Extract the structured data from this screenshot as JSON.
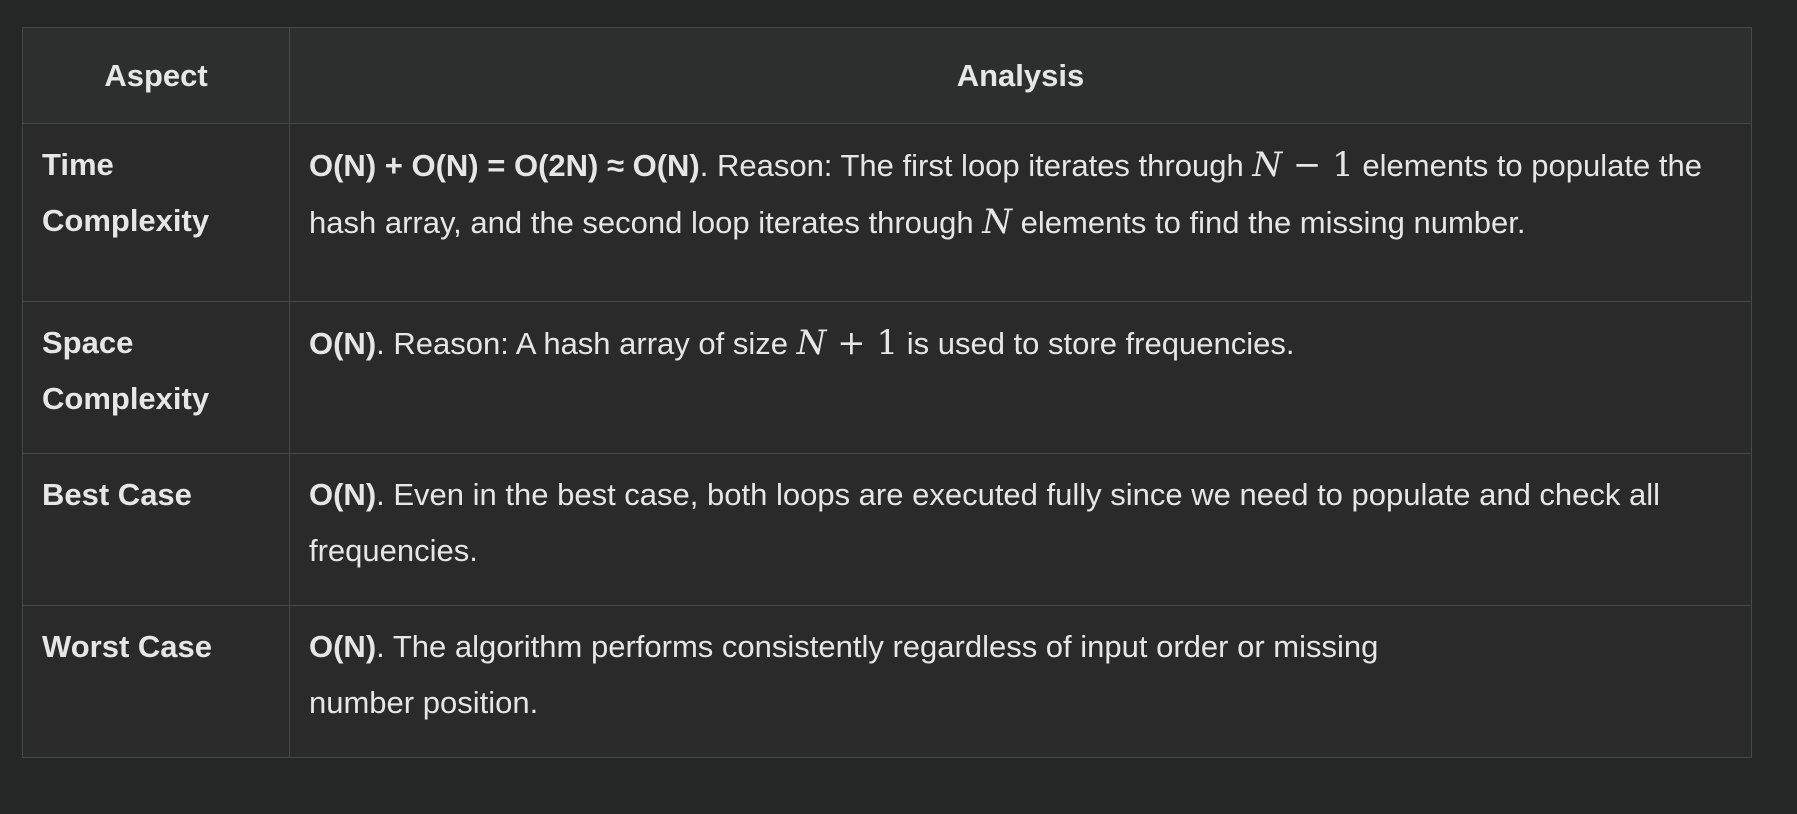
{
  "table": {
    "headers": [
      "Aspect",
      "Analysis"
    ],
    "rows": [
      {
        "aspect_line1": "Time",
        "aspect_line2": "Complexity",
        "lead": "O(N) + O(N) = O(2N) ≈ O(N)",
        "text_a": ". Reason: The first loop iterates through ",
        "math_a_var": "N",
        "math_a_rest": " − 1",
        "text_b": " elements to populate the hash array, and the second loop iterates through ",
        "math_b_var": "N",
        "text_c": " elements to find the missing number."
      },
      {
        "aspect_line1": "Space",
        "aspect_line2": "Complexity",
        "lead": "O(N)",
        "text_a": ". Reason: A hash array of size ",
        "math_a_var": "N",
        "math_a_rest": " + 1",
        "text_b": " is used to store frequencies."
      },
      {
        "aspect": "Best Case",
        "lead": "O(N)",
        "text_a": ". Even in the best case, both loops are executed fully since we need to populate and check all frequencies."
      },
      {
        "aspect": "Worst Case",
        "lead": "O(N)",
        "text_a": ". The algorithm performs consistently regardless of input order or missing",
        "text_b": "number position."
      }
    ]
  }
}
